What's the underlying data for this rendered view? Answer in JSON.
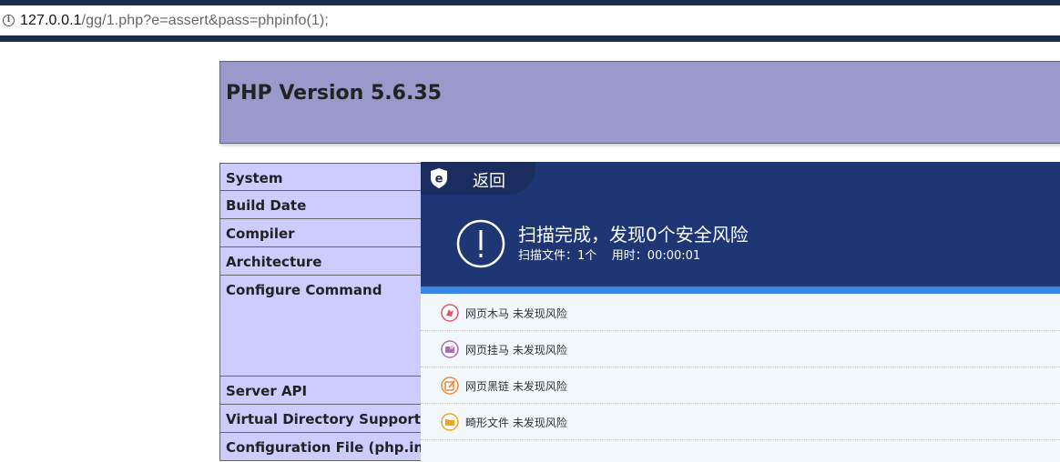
{
  "browser": {
    "url_host": "127.0.0.1",
    "url_rest": "/gg/1.php?e=assert&pass=phpinfo(1);"
  },
  "phpinfo": {
    "title": "PHP Version 5.6.35",
    "rows": [
      {
        "label": "System"
      },
      {
        "label": "Build Date"
      },
      {
        "label": "Compiler"
      },
      {
        "label": "Architecture"
      },
      {
        "label": "Configure Command"
      },
      {
        "label": "Server API"
      },
      {
        "label": "Virtual Directory Support"
      },
      {
        "label": "Configuration File (php.ini) P"
      }
    ]
  },
  "scanner": {
    "back_label": "返回",
    "title": "扫描完成，发现0个安全风险",
    "subtitle": "扫描文件：1个    用时：00:00:01",
    "results": [
      {
        "label": "网页木马 未发现风险",
        "icon": "trojan-icon",
        "color": "#e0556a"
      },
      {
        "label": "网页挂马 未发现风险",
        "icon": "hanging-horse-icon",
        "color": "#b06bb8"
      },
      {
        "label": "网页黑链 未发现风险",
        "icon": "black-link-icon",
        "color": "#ee8a3b"
      },
      {
        "label": "畸形文件 未发现风险",
        "icon": "folder-icon",
        "color": "#f0a41f"
      }
    ],
    "colors": {
      "header_bg": "#1e3673",
      "accent_bar": "#3b86e0",
      "list_bg": "#f3f8fc"
    }
  }
}
